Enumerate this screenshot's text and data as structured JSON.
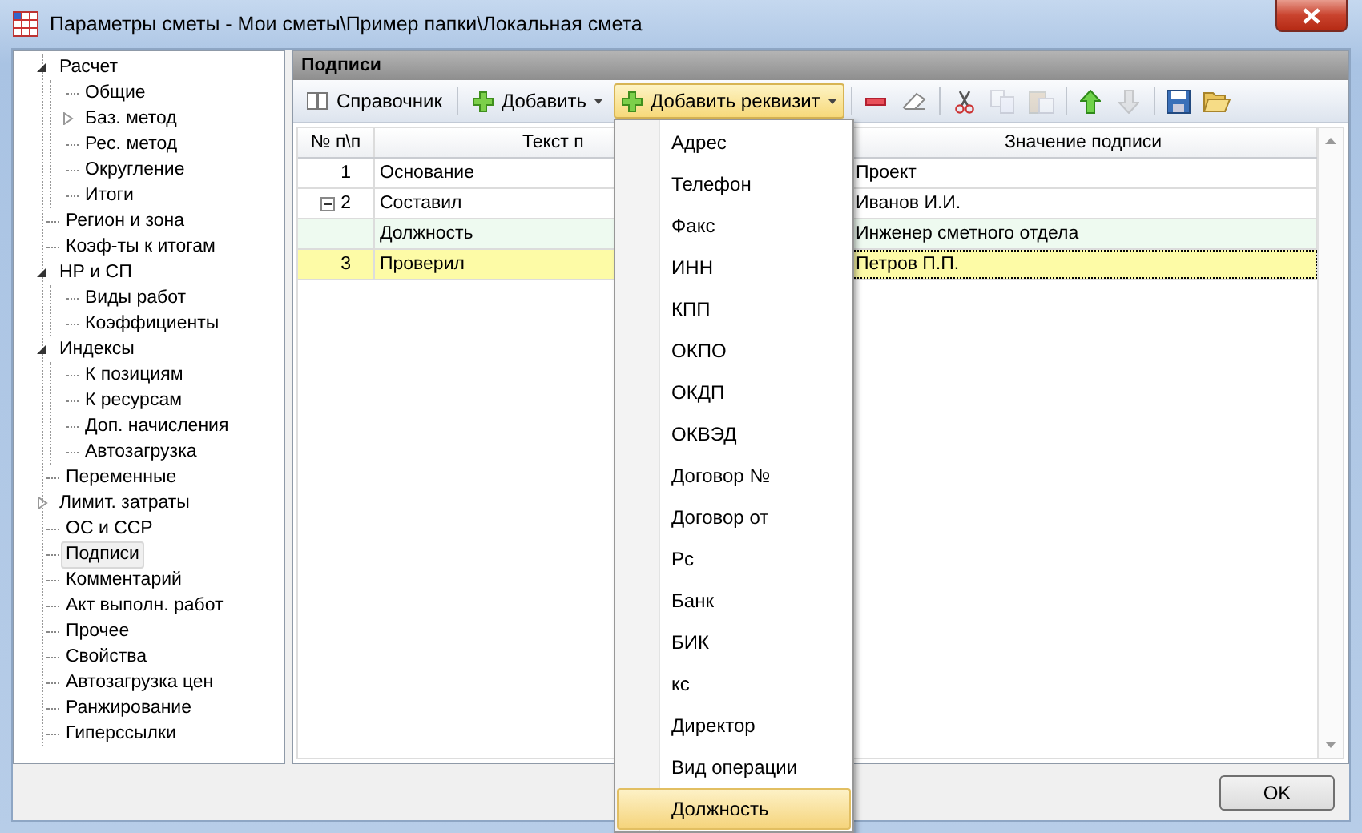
{
  "window": {
    "title": "Параметры сметы - Мои сметы\\Пример папки\\Локальная смета"
  },
  "tree": [
    {
      "label": "Расчет",
      "selected": false,
      "expanded": true,
      "children": [
        {
          "label": "Общие",
          "selected": false
        },
        {
          "label": "Баз. метод",
          "selected": false,
          "expanded": false
        },
        {
          "label": "Рес. метод",
          "selected": false
        },
        {
          "label": "Округление",
          "selected": false
        },
        {
          "label": "Итоги",
          "selected": false
        }
      ]
    },
    {
      "label": "Регион и зона",
      "selected": false
    },
    {
      "label": "Коэф-ты к итогам",
      "selected": false
    },
    {
      "label": "НР и СП",
      "selected": false,
      "expanded": true,
      "children": [
        {
          "label": "Виды работ",
          "selected": false
        },
        {
          "label": "Коэффициенты",
          "selected": false
        }
      ]
    },
    {
      "label": "Индексы",
      "selected": false,
      "expanded": true,
      "children": [
        {
          "label": "К позициям",
          "selected": false
        },
        {
          "label": "К ресурсам",
          "selected": false
        },
        {
          "label": "Доп. начисления",
          "selected": false
        },
        {
          "label": "Автозагрузка",
          "selected": false
        }
      ]
    },
    {
      "label": "Переменные",
      "selected": false
    },
    {
      "label": "Лимит. затраты",
      "selected": false,
      "expanded": false
    },
    {
      "label": "ОС и ССР",
      "selected": false
    },
    {
      "label": "Подписи",
      "selected": true
    },
    {
      "label": "Комментарий",
      "selected": false
    },
    {
      "label": "Акт выполн. работ",
      "selected": false
    },
    {
      "label": "Прочее",
      "selected": false
    },
    {
      "label": "Свойства",
      "selected": false
    },
    {
      "label": "Автозагрузка цен",
      "selected": false
    },
    {
      "label": "Ранжирование",
      "selected": false
    },
    {
      "label": "Гиперссылки",
      "selected": false
    }
  ],
  "panel": {
    "title": "Подписи"
  },
  "toolbar": [
    [
      {
        "kind": "book",
        "label": "Справочник",
        "pressed": false
      }
    ],
    [
      {
        "kind": "add",
        "label": "Добавить",
        "dropdown": true,
        "pressed": false
      },
      {
        "kind": "add",
        "label": "Добавить реквизит",
        "dropdown": true,
        "pressed": true
      }
    ],
    [
      {
        "kind": "remove",
        "disabled": false
      },
      {
        "kind": "erase",
        "disabled": false
      }
    ],
    [
      {
        "kind": "cut",
        "disabled": false
      },
      {
        "kind": "copy",
        "disabled": true
      },
      {
        "kind": "paste",
        "disabled": true
      }
    ],
    [
      {
        "kind": "up",
        "disabled": false
      },
      {
        "kind": "down",
        "disabled": true
      }
    ],
    [
      {
        "kind": "save",
        "disabled": false
      },
      {
        "kind": "open",
        "disabled": false
      }
    ]
  ],
  "table": {
    "columns": [
      "№ п\\п",
      "Текст п",
      "Значение подписи"
    ],
    "rows": [
      {
        "number": "1",
        "text": "Основание",
        "value": "Проект",
        "selected": false
      },
      {
        "number": "2",
        "text": "Составил",
        "value": "Иванов И.И.",
        "selected": false,
        "expanded": true,
        "children": [
          {
            "text": "Должность",
            "value": "Инженер сметного отдела",
            "selected": false
          }
        ]
      },
      {
        "number": "3",
        "text": "Проверил",
        "value": "Петров П.П.",
        "selected": true
      }
    ]
  },
  "menu": [
    {
      "label": "Адрес",
      "selected": false
    },
    {
      "label": "Телефон",
      "selected": false
    },
    {
      "label": "Факс",
      "selected": false
    },
    {
      "label": "ИНН",
      "selected": false
    },
    {
      "label": "КПП",
      "selected": false
    },
    {
      "label": "ОКПО",
      "selected": false
    },
    {
      "label": "ОКДП",
      "selected": false
    },
    {
      "label": "ОКВЭД",
      "selected": false
    },
    {
      "label": "Договор №",
      "selected": false
    },
    {
      "label": "Договор от",
      "selected": false
    },
    {
      "label": "Рс",
      "selected": false
    },
    {
      "label": "Банк",
      "selected": false
    },
    {
      "label": "БИК",
      "selected": false
    },
    {
      "label": "кс",
      "selected": false
    },
    {
      "label": "Директор",
      "selected": false
    },
    {
      "label": "Вид операции",
      "selected": false
    },
    {
      "label": "Должность",
      "selected": true
    }
  ],
  "buttons": [
    "OK"
  ]
}
